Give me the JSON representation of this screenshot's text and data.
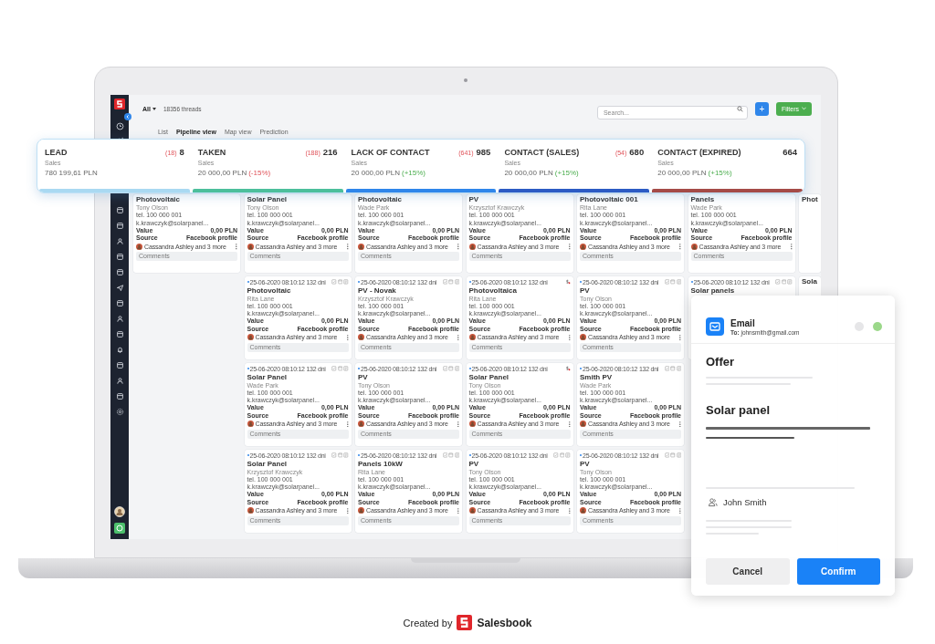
{
  "header": {
    "filter": "All",
    "threads": "18356 threads",
    "search_placeholder": "Search...",
    "add_button": "+",
    "filters_button": "Filters"
  },
  "tabs": [
    {
      "label": "List",
      "selected": false
    },
    {
      "label": "Pipeline view",
      "selected": true
    },
    {
      "label": "Map view",
      "selected": false
    },
    {
      "label": "Prediction",
      "selected": false
    }
  ],
  "stages": [
    {
      "name": "LEAD",
      "count_note": "(18)",
      "count": "8",
      "subtitle": "Sales",
      "amount": "780 199,61 PLN",
      "color": "#a9d9f2"
    },
    {
      "name": "TAKEN",
      "count_note": "(188)",
      "count": "216",
      "subtitle": "Sales",
      "amount": "20 000,00 PLN",
      "change": "(-15%)",
      "negative": true,
      "color": "#4cbf9c"
    },
    {
      "name": "LACK OF CONTACT",
      "count_note": "(641)",
      "count": "985",
      "subtitle": "Sales",
      "amount": "20 000,00 PLN",
      "change": "(+15%)",
      "negative": false,
      "color": "#2f86ea"
    },
    {
      "name": "CONTACT (SALES)",
      "count_note": "(54)",
      "count": "680",
      "subtitle": "Sales",
      "amount": "20 000,00 PLN",
      "change": "(+15%)",
      "negative": false,
      "color": "#2c5bc4"
    },
    {
      "name": "CONTACT (EXPIRED)",
      "count": "664",
      "subtitle": "Sales",
      "amount": "20 000,00 PLN",
      "change": "(+15%)",
      "negative": false,
      "color": "#a54b47"
    }
  ],
  "columns": [
    {
      "cards": [
        {
          "title": "Photovoltaic",
          "person": "Tony Olson",
          "phone": "tel. 100 000 001",
          "email": "k.krawczyk@solarpanel...",
          "value_label": "Value",
          "value": "0,00 PLN",
          "source_label": "Source",
          "source": "Facebook profile",
          "assignees": "Cassandra Ashley and 3 more",
          "comments": "Comments"
        }
      ]
    },
    {
      "cards": [
        {
          "title": "Solar Panel",
          "person": "Tony Olson",
          "phone": "tel. 100 000 001",
          "email": "k.krawczyk@solarpanel...",
          "value_label": "Value",
          "value": "0,00 PLN",
          "source_label": "Source",
          "source": "Facebook profile",
          "assignees": "Cassandra Ashley and 3 more",
          "comments": "Comments"
        },
        {
          "date": "25-06-2020 08:10:12 132 dni",
          "kind": "tasks",
          "title": "Photovoltaic",
          "person": "Rita Lane",
          "phone": "tel. 100 000 001",
          "email": "k.krawczyk@solarpanel...",
          "value_label": "Value",
          "value": "0,00 PLN",
          "source_label": "Source",
          "source": "Facebook profile",
          "assignees": "Cassandra Ashley and 3 more",
          "comments": "Comments"
        },
        {
          "date": "25-06-2020 08:10:12 132 dni",
          "kind": "tasks",
          "title": "Solar Panel",
          "person": "Wade Park",
          "phone": "tel. 100 000 001",
          "email": "k.krawczyk@solarpanel...",
          "value_label": "Value",
          "value": "0,00 PLN",
          "source_label": "Source",
          "source": "Facebook profile",
          "assignees": "Cassandra Ashley and 3 more",
          "comments": "Comments"
        },
        {
          "date": "25-06-2020 08:10:12 132 dni",
          "kind": "tasks",
          "title": "Solar Panel",
          "person": "Krzysztof Krawczyk",
          "phone": "tel. 100 000 001",
          "email": "k.krawczyk@solarpanel...",
          "value_label": "Value",
          "value": "0,00 PLN",
          "source_label": "Source",
          "source": "Facebook profile",
          "assignees": "Cassandra Ashley and 3 more",
          "comments": "Comments"
        }
      ]
    },
    {
      "cards": [
        {
          "title": "Photovoltaic",
          "person": "Wade Park",
          "phone": "tel. 100 000 001",
          "email": "k.krawczyk@solarpanel...",
          "value_label": "Value",
          "value": "0,00 PLN",
          "source_label": "Source",
          "source": "Facebook profile",
          "assignees": "Cassandra Ashley and 3 more",
          "comments": "Comments"
        },
        {
          "date": "25-06-2020 08:10:12 132 dni",
          "kind": "tasks",
          "title": "PV - Novak",
          "person": "Krzysztof Krawczyk",
          "phone": "tel. 100 000 001",
          "email": "k.krawczyk@solarpanel...",
          "value_label": "Value",
          "value": "0,00 PLN",
          "source_label": "Source",
          "source": "Facebook profile",
          "assignees": "Cassandra Ashley and 3 more",
          "comments": "Comments"
        },
        {
          "date": "25-06-2020 08:10:12 132 dni",
          "kind": "tasks",
          "title": "PV",
          "person": "Tony Olson",
          "phone": "tel. 100 000 001",
          "email": "k.krawczyk@solarpanel...",
          "value_label": "Value",
          "value": "0,00 PLN",
          "source_label": "Source",
          "source": "Facebook profile",
          "assignees": "Cassandra Ashley and 3 more",
          "comments": "Comments"
        },
        {
          "date": "25-06-2020 08:10:12 132 dni",
          "kind": "tasks",
          "title": "Panels 10kW",
          "person": "Rita Lane",
          "phone": "tel. 100 000 001",
          "email": "k.krawczyk@solarpanel...",
          "value_label": "Value",
          "value": "0,00 PLN",
          "source_label": "Source",
          "source": "Facebook profile",
          "assignees": "Cassandra Ashley and 3 more",
          "comments": "Comments"
        }
      ]
    },
    {
      "cards": [
        {
          "title": "PV",
          "person": "Krzysztof Krawczyk",
          "phone": "tel. 100 000 001",
          "email": "k.krawczyk@solarpanel...",
          "value_label": "Value",
          "value": "0,00 PLN",
          "source_label": "Source",
          "source": "Facebook profile",
          "assignees": "Cassandra Ashley and 3 more",
          "comments": "Comments"
        },
        {
          "date": "25-06-2020 08:10:12 132 dni",
          "kind": "payment",
          "title": "Photovoltaica",
          "person": "Rita Lane",
          "phone": "tel. 100 000 001",
          "email": "k.krawczyk@solarpanel...",
          "value_label": "Value",
          "value": "0,00 PLN",
          "source_label": "Source",
          "source": "Facebook profile",
          "assignees": "Cassandra Ashley and 3 more",
          "comments": "Comments"
        },
        {
          "date": "25-06-2020 08:10:12 132 dni",
          "kind": "payment",
          "title": "Solar Panel",
          "person": "Tony Olson",
          "phone": "tel. 100 000 001",
          "email": "k.krawczyk@solarpanel...",
          "value_label": "Value",
          "value": "0,00 PLN",
          "source_label": "Source",
          "source": "Facebook profile",
          "assignees": "Cassandra Ashley and 3 more",
          "comments": "Comments"
        },
        {
          "date": "25-06-2020 08:10:12 132 dni",
          "kind": "tasks",
          "title": "PV",
          "person": "Tony Olson",
          "phone": "tel. 100 000 001",
          "email": "k.krawczyk@solarpanel...",
          "value_label": "Value",
          "value": "0,00 PLN",
          "source_label": "Source",
          "source": "Facebook profile",
          "assignees": "Cassandra Ashley and 3 more",
          "comments": "Comments"
        }
      ]
    },
    {
      "cards": [
        {
          "title": "Photovoltaic 001",
          "person": "Rita Lane",
          "phone": "tel. 100 000 001",
          "email": "k.krawczyk@solarpanel...",
          "value_label": "Value",
          "value": "0,00 PLN",
          "source_label": "Source",
          "source": "Facebook profile",
          "assignees": "Cassandra Ashley and 3 more",
          "comments": "Comments"
        },
        {
          "date": "25-06-2020 08:10:12 132 dni",
          "kind": "tasks",
          "title": "PV",
          "person": "Tony Olson",
          "phone": "tel. 100 000 001",
          "email": "k.krawczyk@solarpanel...",
          "value_label": "Value",
          "value": "0,00 PLN",
          "source_label": "Source",
          "source": "Facebook profile",
          "assignees": "Cassandra Ashley and 3 more",
          "comments": "Comments"
        },
        {
          "date": "25-06-2020 08:10:12 132 dni",
          "kind": "tasks",
          "title": "Smith PV",
          "person": "Wade Park",
          "phone": "tel. 100 000 001",
          "email": "k.krawczyk@solarpanel...",
          "value_label": "Value",
          "value": "0,00 PLN",
          "source_label": "Source",
          "source": "Facebook profile",
          "assignees": "Cassandra Ashley and 3 more",
          "comments": "Comments"
        },
        {
          "date": "25-06-2020 08:10:12 132 dni",
          "kind": "tasks",
          "title": "PV",
          "person": "Tony Olson",
          "phone": "tel. 100 000 001",
          "email": "k.krawczyk@solarpanel...",
          "value_label": "Value",
          "value": "0,00 PLN",
          "source_label": "Source",
          "source": "Facebook profile",
          "assignees": "Cassandra Ashley and 3 more",
          "comments": "Comments"
        }
      ]
    },
    {
      "cards": [
        {
          "title": "Panels",
          "person": "Wade Park",
          "phone": "tel. 100 000 001",
          "email": "k.krawczyk@solarpanel...",
          "value_label": "Value",
          "value": "0,00 PLN",
          "source_label": "Source",
          "source": "Facebook profile",
          "assignees": "Cassandra Ashley and 3 more",
          "comments": "Comments"
        },
        {
          "date": "25-06-2020 08:10:12 132 dni",
          "kind": "tasks",
          "title": "Solar panels"
        }
      ]
    },
    {
      "cards": [
        {
          "title": "Phot"
        },
        {
          "title": "Sola"
        }
      ]
    }
  ],
  "email": {
    "title": "Email",
    "recipient": "**To:** johnsmith@gmail.com",
    "subject": "Offer",
    "product": "Solar panel",
    "contact": "John Smith",
    "cancel": "Cancel",
    "confirm": "Confirm"
  },
  "footer": {
    "prefix": "Created by",
    "brand": "Salesbook"
  }
}
